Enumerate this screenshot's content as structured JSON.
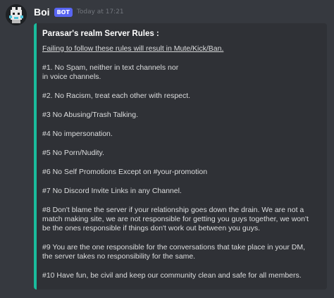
{
  "message": {
    "username": "Boi",
    "badge": "BOT",
    "timestamp": "Today at 17:21",
    "avatar_icon": "boi-avatar-icon",
    "embed_color": "#1abc9c"
  },
  "embed": {
    "title": "Parasar's realm Server Rules :",
    "warning": "Failing to follow these rules will result in Mute/Kick/Ban.",
    "rules": [
      "#1. No Spam, neither in text channels nor\nin voice channels.",
      "#2. No Racism, treat each other with respect.",
      "#3 No Abusing/Trash Talking.",
      "#4 No impersonation.",
      "#5 No Porn/Nudity.",
      "#6 No Self Promotions Except on #your-promotion",
      "#7 No Discord Invite Links in any Channel.",
      "#8 Don't blame the server if your relationship goes down the drain. We are not a\nmatch making site, we are not responsible for getting you guys together, we won't\nbe the ones responsible if things don't work out between you guys.",
      "#9 You are the one responsible for the conversations that take place in your DM,\nthe server takes no responsibility for the same.",
      "#10 Have fun, be civil and keep our community clean and safe for all members."
    ]
  }
}
